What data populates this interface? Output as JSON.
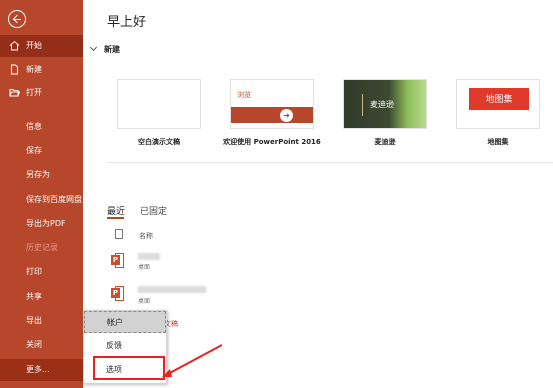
{
  "sidebar": {
    "nav": [
      {
        "name": "nav-home",
        "label": "开始",
        "selected": true,
        "icon": "home-icon"
      },
      {
        "name": "nav-new",
        "label": "新建",
        "icon": "new-file-icon"
      },
      {
        "name": "nav-open",
        "label": "打开",
        "icon": "folder-open-icon"
      },
      {
        "name": "nav-info",
        "label": "信息"
      },
      {
        "name": "nav-save",
        "label": "保存"
      },
      {
        "name": "nav-save-as",
        "label": "另存为"
      },
      {
        "name": "nav-save-baidu",
        "label": "保存到百度网盘"
      },
      {
        "name": "nav-export-pdf",
        "label": "导出为PDF"
      },
      {
        "name": "nav-history",
        "label": "历史记录",
        "disabled": true
      },
      {
        "name": "nav-print",
        "label": "打印"
      },
      {
        "name": "nav-share",
        "label": "共享"
      },
      {
        "name": "nav-export",
        "label": "导出"
      },
      {
        "name": "nav-close",
        "label": "关闭"
      },
      {
        "name": "nav-more",
        "label": "更多..."
      }
    ]
  },
  "popup": {
    "items": [
      {
        "label": "帐户"
      },
      {
        "label": "反馈"
      },
      {
        "label": "选项"
      }
    ]
  },
  "main": {
    "greeting": "早上好",
    "new_section": "新建",
    "templates": [
      {
        "label": "空白演示文稿"
      },
      {
        "label": "欢迎使用 PowerPoint 2016",
        "thumb_title": "浏览",
        "thumb_arrow": "➜"
      },
      {
        "label": "麦迪逊",
        "thumb_title": "麦迪逊"
      },
      {
        "label": "地图集",
        "thumb_title": "地图集"
      }
    ],
    "tabs": {
      "recent": "最近",
      "pinned": "已固定"
    },
    "column_name": "名称",
    "files": [
      {
        "sub": "桌面"
      },
      {
        "sub": "桌面"
      }
    ],
    "link_fragment": "文稿"
  },
  "colors": {
    "accent": "#b7472a",
    "sidebar_selected": "#952e19",
    "callout": "#e8231b"
  }
}
